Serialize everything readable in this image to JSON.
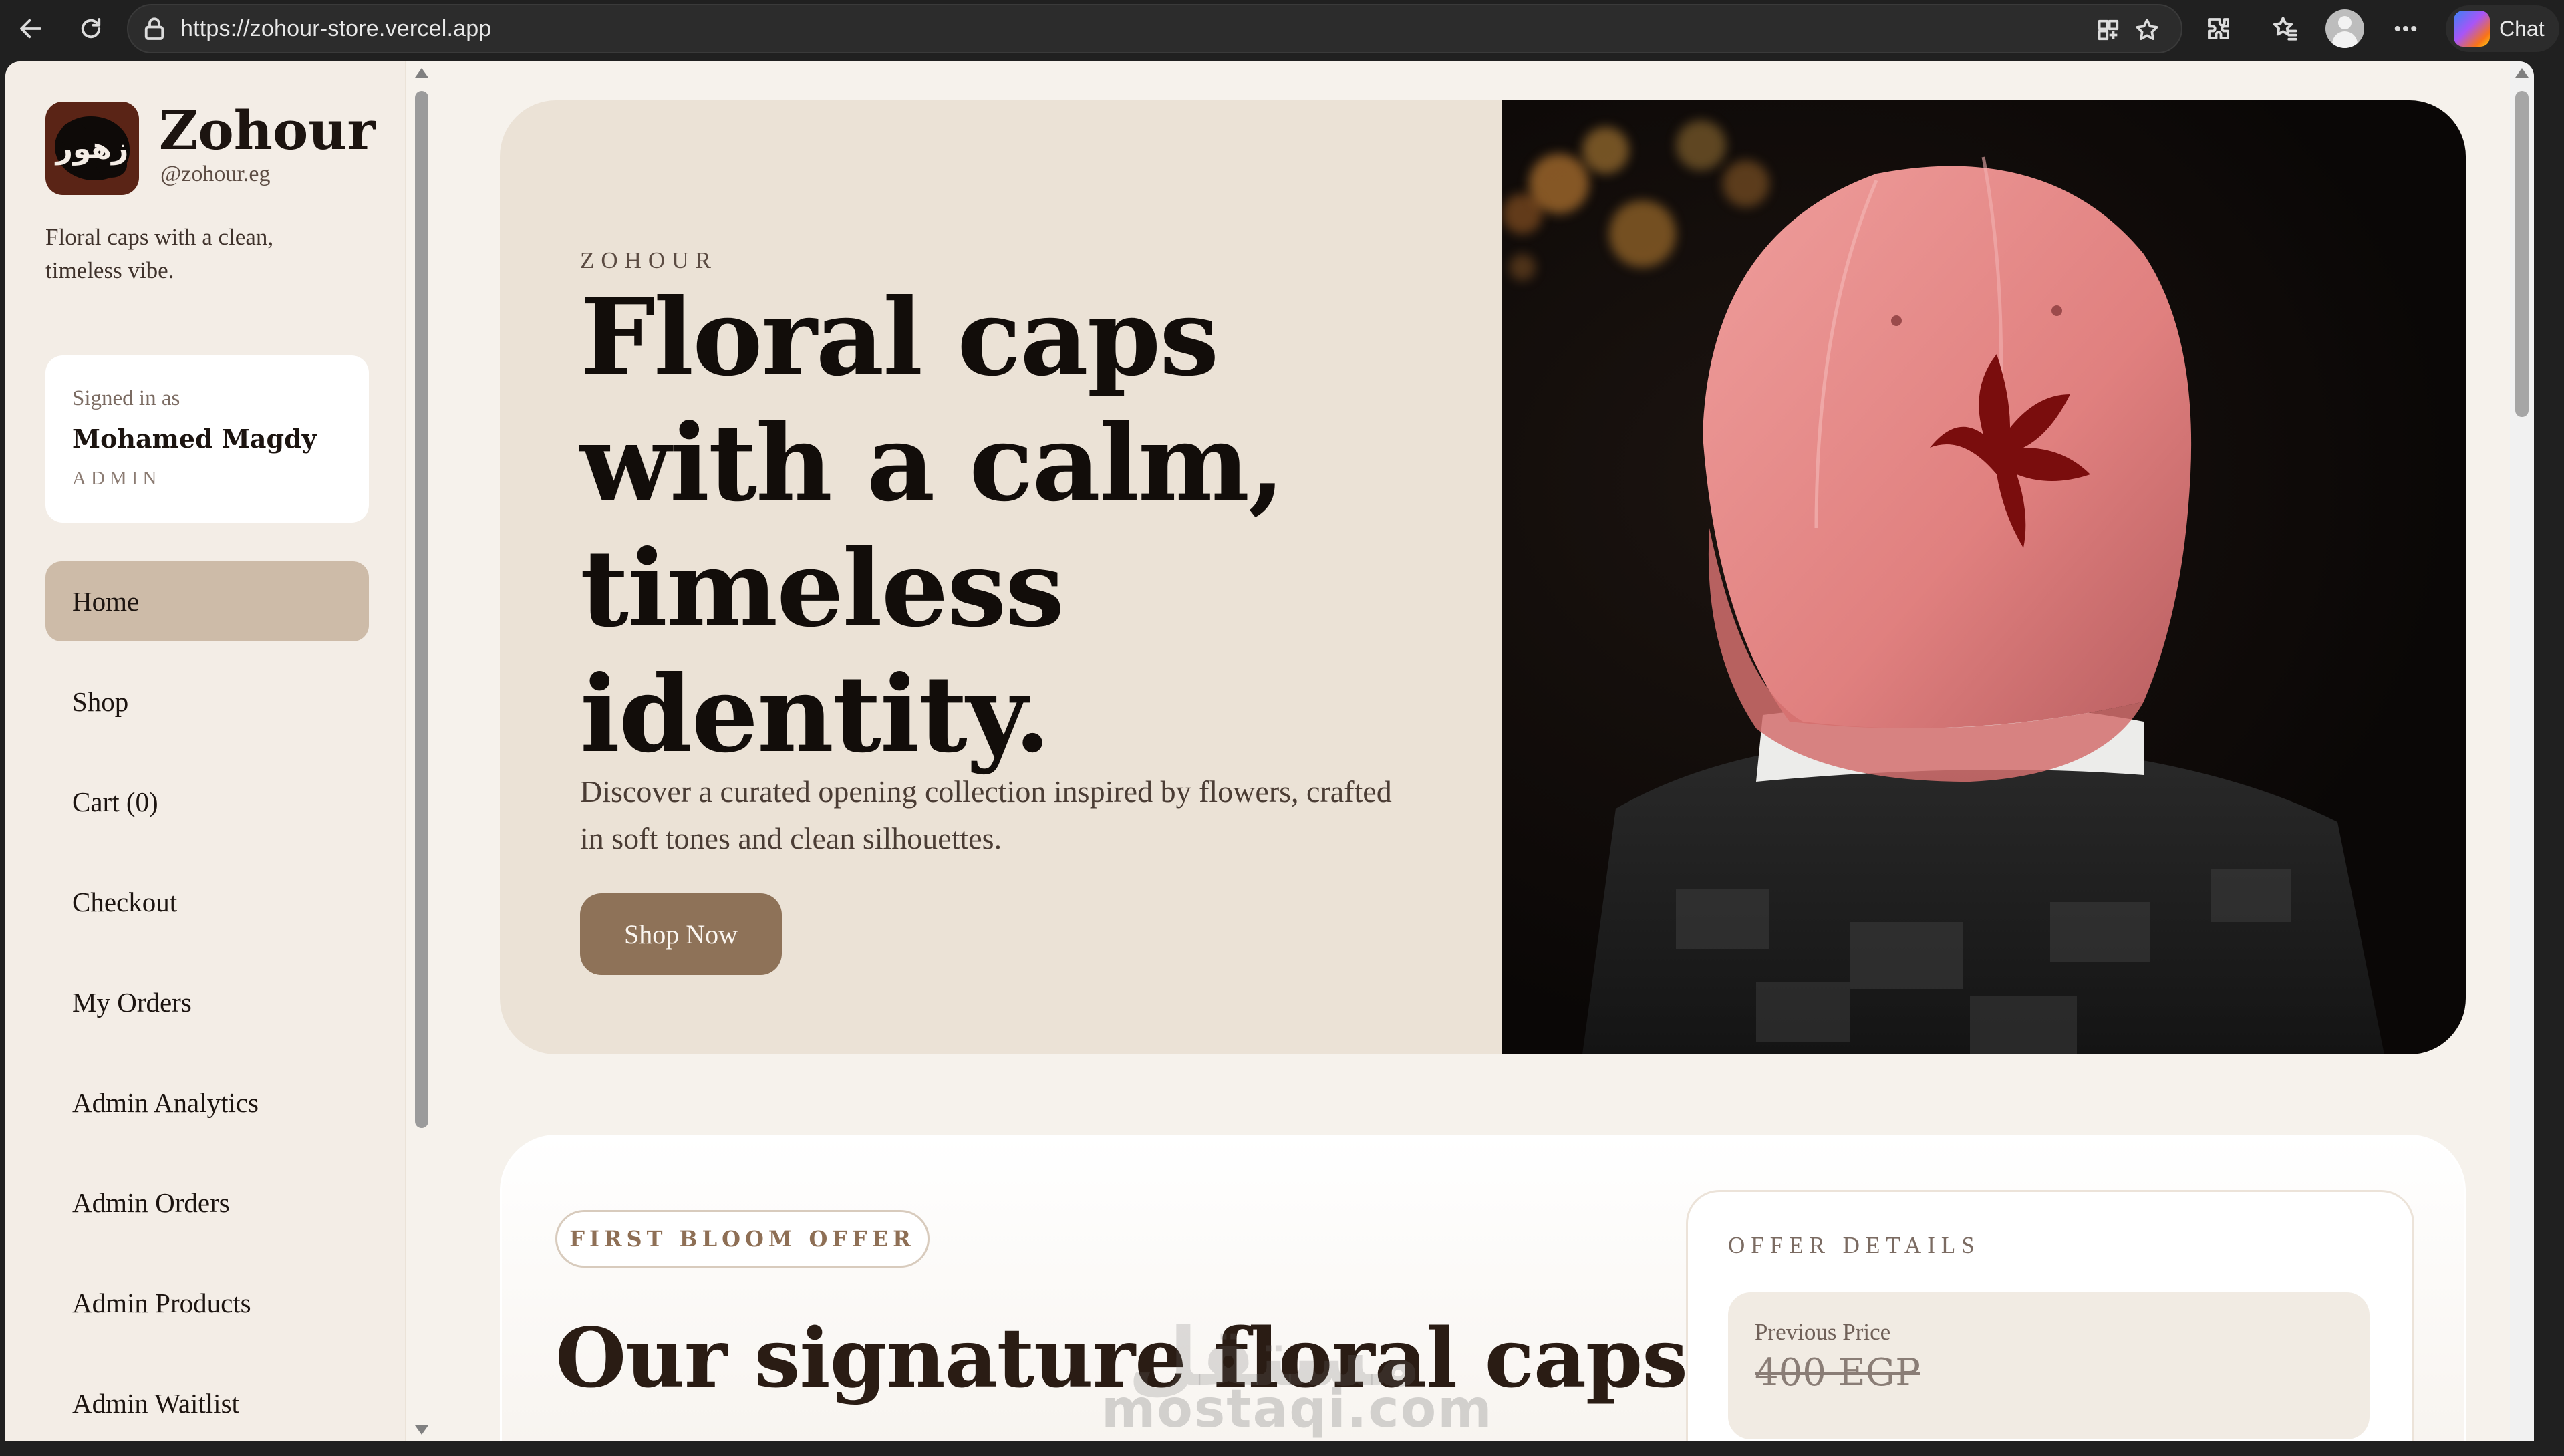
{
  "browser": {
    "url": "https://zohour-store.vercel.app",
    "chat_label": "Chat",
    "icons": [
      "back-icon",
      "refresh-icon",
      "lock-icon",
      "apps-icon",
      "star-icon",
      "extensions-icon",
      "favorites-icon",
      "profile-icon",
      "more-icon",
      "copilot-icon"
    ]
  },
  "sidebar": {
    "brand_name": "Zohour",
    "brand_handle": "@zohour.eg",
    "tagline": "Floral caps with a clean, timeless vibe.",
    "logo_glyph": "زهور",
    "user": {
      "signed_in_label": "Signed in as",
      "name": "Mohamed Magdy",
      "role": "ADMIN"
    },
    "nav": [
      {
        "label": "Home",
        "active": true
      },
      {
        "label": "Shop"
      },
      {
        "label": "Cart (0)"
      },
      {
        "label": "Checkout"
      },
      {
        "label": "My Orders"
      },
      {
        "label": "Admin Analytics"
      },
      {
        "label": "Admin Orders"
      },
      {
        "label": "Admin Products"
      },
      {
        "label": "Admin Waitlist"
      }
    ]
  },
  "hero": {
    "eyebrow": "ZOHOUR",
    "title": "Floral caps with a calm, timeless identity.",
    "description": "Discover a curated opening collection inspired by flowers, crafted in soft tones and clean silhouettes.",
    "cta_label": "Shop Now"
  },
  "offer": {
    "pill": "FIRST BLOOM OFFER",
    "title": "Our signature floral caps",
    "details_label": "OFFER DETAILS",
    "previous_price_label": "Previous Price",
    "previous_price": "400 EGP"
  },
  "watermark": {
    "latin": "mostaqi.com",
    "arabic": "مستقل"
  },
  "colors": {
    "sidebar_bg": "#f3ede6",
    "page_bg": "#f6f2ec",
    "hero_bg": "#ebe2d6",
    "nav_active": "#cdbba8",
    "cta_bg": "#8e7258",
    "cap_pink": "#e48a8a",
    "flower_red": "#7a0d0d"
  }
}
